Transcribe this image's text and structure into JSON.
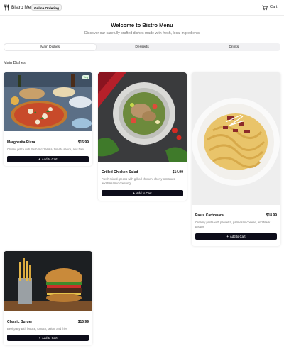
{
  "header": {
    "brand": "Bistro Menu",
    "badge": "Online Ordering",
    "cart_label": "Cart"
  },
  "hero": {
    "title": "Welcome to Bistro Menu",
    "subtitle": "Discover our carefully crafted dishes made with fresh, local ingredients"
  },
  "tabs": [
    {
      "label": "Main Dishes",
      "active": true
    },
    {
      "label": "Desserts",
      "active": false
    },
    {
      "label": "Drinks",
      "active": false
    }
  ],
  "section_title": "Main Dishes",
  "dishes": [
    {
      "name": "Margherita Pizza",
      "price": "$16.99",
      "description": "Classic pizza with fresh mozzarella, tomato sauce, and basil",
      "badge": "Veg",
      "button": "Add to Cart",
      "image": "pizza-photo"
    },
    {
      "name": "Grilled Chicken Salad",
      "price": "$14.99",
      "description": "Fresh mixed greens with grilled chicken, cherry tomatoes,",
      "description_2": "and balsamic dressing",
      "button": "Add to Cart",
      "image": "salad-photo"
    },
    {
      "name": "Pasta Carbonara",
      "price": "$18.99",
      "description": "Creamy pasta with pancetta, parmesan cheese, and black",
      "description_2": "pepper",
      "button": "Add to Cart",
      "image": "pasta-photo"
    },
    {
      "name": "Classic Burger",
      "price": "$15.99",
      "description": "Beef patty with lettuce, tomato, onion, and fries",
      "button": "Add to Cart",
      "image": "burger-photo"
    }
  ],
  "colors": {
    "button_bg": "#0d0d1a",
    "tab_bg": "#f1f1f3",
    "veg_badge": "#2a8a3a"
  }
}
